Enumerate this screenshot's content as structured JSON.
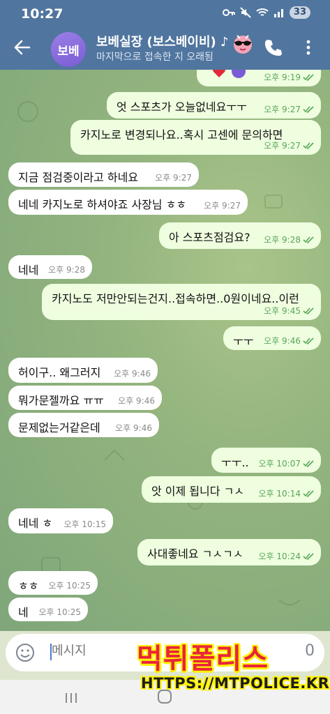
{
  "status_bar": {
    "time": "10:27",
    "battery": "33"
  },
  "header": {
    "avatar_initials": "보베",
    "title": "보베실장 (보스베이비) ♪",
    "subtitle": "마지막으로 접속한 지 오래됨"
  },
  "messages": [
    {
      "dir": "out",
      "text": "",
      "time": "오후 9:19",
      "read": true
    },
    {
      "dir": "out",
      "text": "엇 스포츠가 오늘없네요ㅜㅜ",
      "time": "오후 9:27",
      "read": true
    },
    {
      "dir": "out",
      "text": "카지노로 변경되나요..혹시 고센에 문의하면",
      "time": "오후 9:27",
      "read": true
    },
    {
      "dir": "in",
      "text": "지금 점검중이라고 하네요",
      "time": "오후 9:27"
    },
    {
      "dir": "in",
      "text": "네네 카지노로 하셔야죠 사장님 ㅎㅎ",
      "time": "오후 9:27"
    },
    {
      "dir": "out",
      "text": "아 스포츠점검요?",
      "time": "오후 9:28",
      "read": true
    },
    {
      "dir": "in",
      "text": "네네",
      "time": "오후 9:28"
    },
    {
      "dir": "out",
      "text": "카지노도 저만안되는건지..접속하면..0원이네요..이런",
      "time": "오후 9:45",
      "read": true
    },
    {
      "dir": "out",
      "text": "ㅜㅜ",
      "time": "오후 9:46",
      "read": true
    },
    {
      "dir": "in",
      "text": "허이구.. 왜그러지",
      "time": "오후 9:46"
    },
    {
      "dir": "in",
      "text": "뭐가문젤까요 ㅠㅠ",
      "time": "오후 9:46"
    },
    {
      "dir": "in",
      "text": "문제없는거같은데",
      "time": "오후 9:46"
    },
    {
      "dir": "out",
      "text": "ㅜㅜ..",
      "time": "오후 10:07",
      "read": true
    },
    {
      "dir": "out",
      "text": "앗 이제 됩니다 ㄱㅅ",
      "time": "오후 10:14",
      "read": true
    },
    {
      "dir": "in",
      "text": "네네 ㅎ",
      "time": "오후 10:15"
    },
    {
      "dir": "out",
      "text": "사대좋네요 ㄱㅅㄱㅅ",
      "time": "오후 10:24",
      "read": true
    },
    {
      "dir": "in",
      "text": "ㅎㅎ",
      "time": "오후 10:25"
    },
    {
      "dir": "in",
      "text": "네",
      "time": "오후 10:25"
    }
  ],
  "composer": {
    "placeholder": "메시지",
    "right_digit": "0"
  },
  "watermark": {
    "main": "먹튀폴리스",
    "sub": "HTTPS://MTPOLICE.KR"
  },
  "colors": {
    "header": "#50759f",
    "outgoing_bubble": "#eefedf",
    "incoming_bubble": "#ffffff",
    "read_check": "#5aa55a",
    "watermark_red": "#e8243c",
    "watermark_yellow": "#fff200"
  }
}
